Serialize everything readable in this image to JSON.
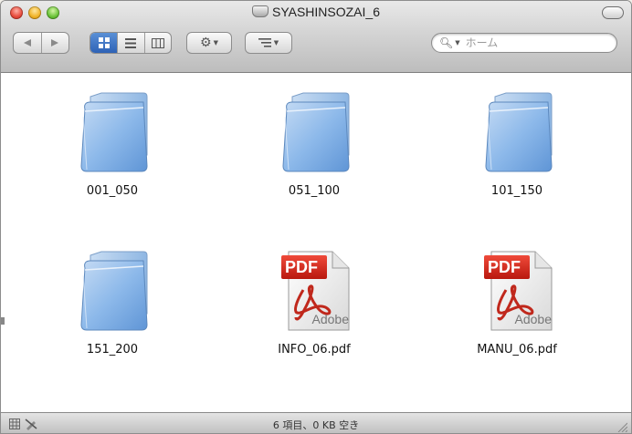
{
  "window": {
    "title": "SYASHINSOZAI_6"
  },
  "toolbar": {
    "search_placeholder": "ホーム"
  },
  "items": [
    {
      "name": "001_050",
      "kind": "folder"
    },
    {
      "name": "051_100",
      "kind": "folder"
    },
    {
      "name": "101_150",
      "kind": "folder"
    },
    {
      "name": "151_200",
      "kind": "folder"
    },
    {
      "name": "INFO_06.pdf",
      "kind": "pdf",
      "badge": "PDF",
      "brand": "Adobe"
    },
    {
      "name": "MANU_06.pdf",
      "kind": "pdf",
      "badge": "PDF",
      "brand": "Adobe"
    }
  ],
  "status": {
    "text": "6 項目、0 KB 空き"
  },
  "colors": {
    "folder_blue": "#7fb0e6",
    "pdf_red": "#d62a1e",
    "selected_view": "#3a6fc2"
  }
}
